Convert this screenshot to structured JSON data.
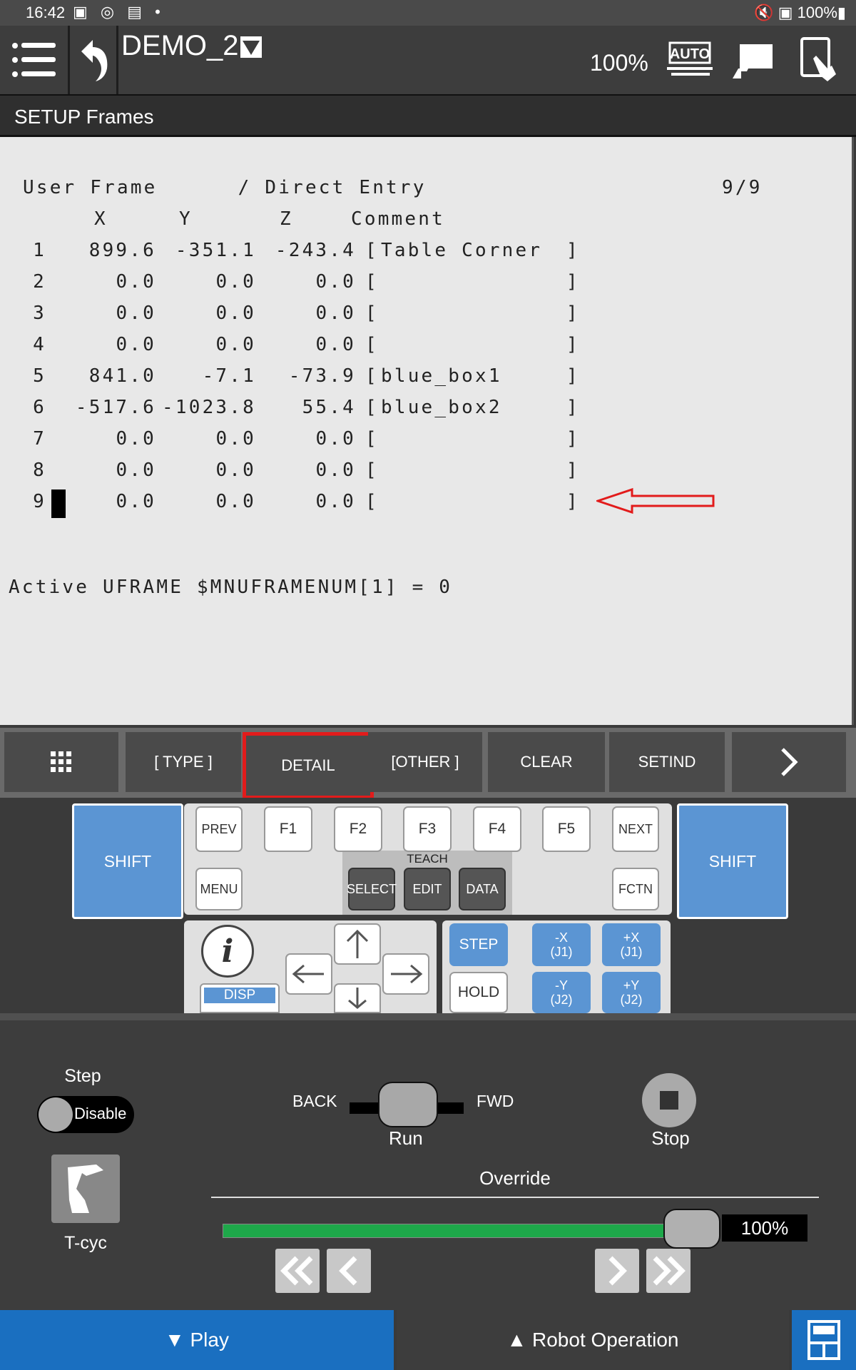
{
  "status_bar": {
    "time": "16:42",
    "left_icons": "▣ ◎ ▤ •",
    "right": "🔇 ▣ 100%▮"
  },
  "header": {
    "program_name": "DEMO_2",
    "speed": "100%",
    "auto_label": "AUTO"
  },
  "title_bar": {
    "title": "SETUP Frames"
  },
  "screen": {
    "heading": {
      "left": "User Frame",
      "mode": "/ Direct Entry",
      "page": "9/9"
    },
    "columns": {
      "x": "X",
      "y": "Y",
      "z": "Z",
      "comment": "Comment"
    },
    "rows": [
      {
        "num": "1",
        "x": "899.6",
        "y": "-351.1",
        "z": "-243.4",
        "comment": "Table Corner"
      },
      {
        "num": "2",
        "x": "0.0",
        "y": "0.0",
        "z": "0.0",
        "comment": ""
      },
      {
        "num": "3",
        "x": "0.0",
        "y": "0.0",
        "z": "0.0",
        "comment": ""
      },
      {
        "num": "4",
        "x": "0.0",
        "y": "0.0",
        "z": "0.0",
        "comment": ""
      },
      {
        "num": "5",
        "x": "841.0",
        "y": "-7.1",
        "z": "-73.9",
        "comment": "blue_box1"
      },
      {
        "num": "6",
        "x": "-517.6",
        "y": "-1023.8",
        "z": "55.4",
        "comment": "blue_box2"
      },
      {
        "num": "7",
        "x": "0.0",
        "y": "0.0",
        "z": "0.0",
        "comment": ""
      },
      {
        "num": "8",
        "x": "0.0",
        "y": "0.0",
        "z": "0.0",
        "comment": ""
      },
      {
        "num": "9",
        "x": "0.0",
        "y": "0.0",
        "z": "0.0",
        "comment": ""
      }
    ],
    "active_line": "Active UFRAME $MNUFRAMENUM[1] = 0",
    "arrow_color": "#e21b1b"
  },
  "function_keys": {
    "menu_icon": "grid-icon",
    "keys": [
      "[ TYPE ]",
      "DETAIL",
      "[OTHER ]",
      "CLEAR",
      "SETIND"
    ],
    "next_icon": "chevron-right-icon",
    "selected": "DETAIL"
  },
  "keypad": {
    "shift": "SHIFT",
    "prev": "PREV",
    "f1": "F1",
    "f2": "F2",
    "f3": "F3",
    "f4": "F4",
    "f5": "F5",
    "next": "NEXT",
    "menu": "MENU",
    "teach": "TEACH",
    "select": "SELECT",
    "edit": "EDIT",
    "data": "DATA",
    "fctn": "FCTN",
    "disp": "DISP",
    "step": "STEP",
    "hold": "HOLD",
    "minus_x": "-X",
    "minus_x_sub": "(J1)",
    "plus_x": "+X",
    "plus_x_sub": "(J1)",
    "minus_y": "-Y",
    "minus_y_sub": "(J2)",
    "plus_y": "+Y",
    "plus_y_sub": "(J2)"
  },
  "run_panel": {
    "step_label": "Step",
    "step_toggle": "Disable",
    "back": "BACK",
    "fwd": "FWD",
    "run": "Run",
    "stop": "Stop",
    "tcyc": "T-cyc",
    "override_label": "Override",
    "override_value": "100%",
    "override_fraction": 1.0
  },
  "bottom_bar": {
    "play": "▼ Play",
    "robot_operation": "▲ Robot Operation"
  },
  "colors": {
    "accent_blue": "#1a6fc0",
    "key_blue": "#5b95d3",
    "override_green": "#1ea84a",
    "highlight_red": "#e21b1b"
  }
}
